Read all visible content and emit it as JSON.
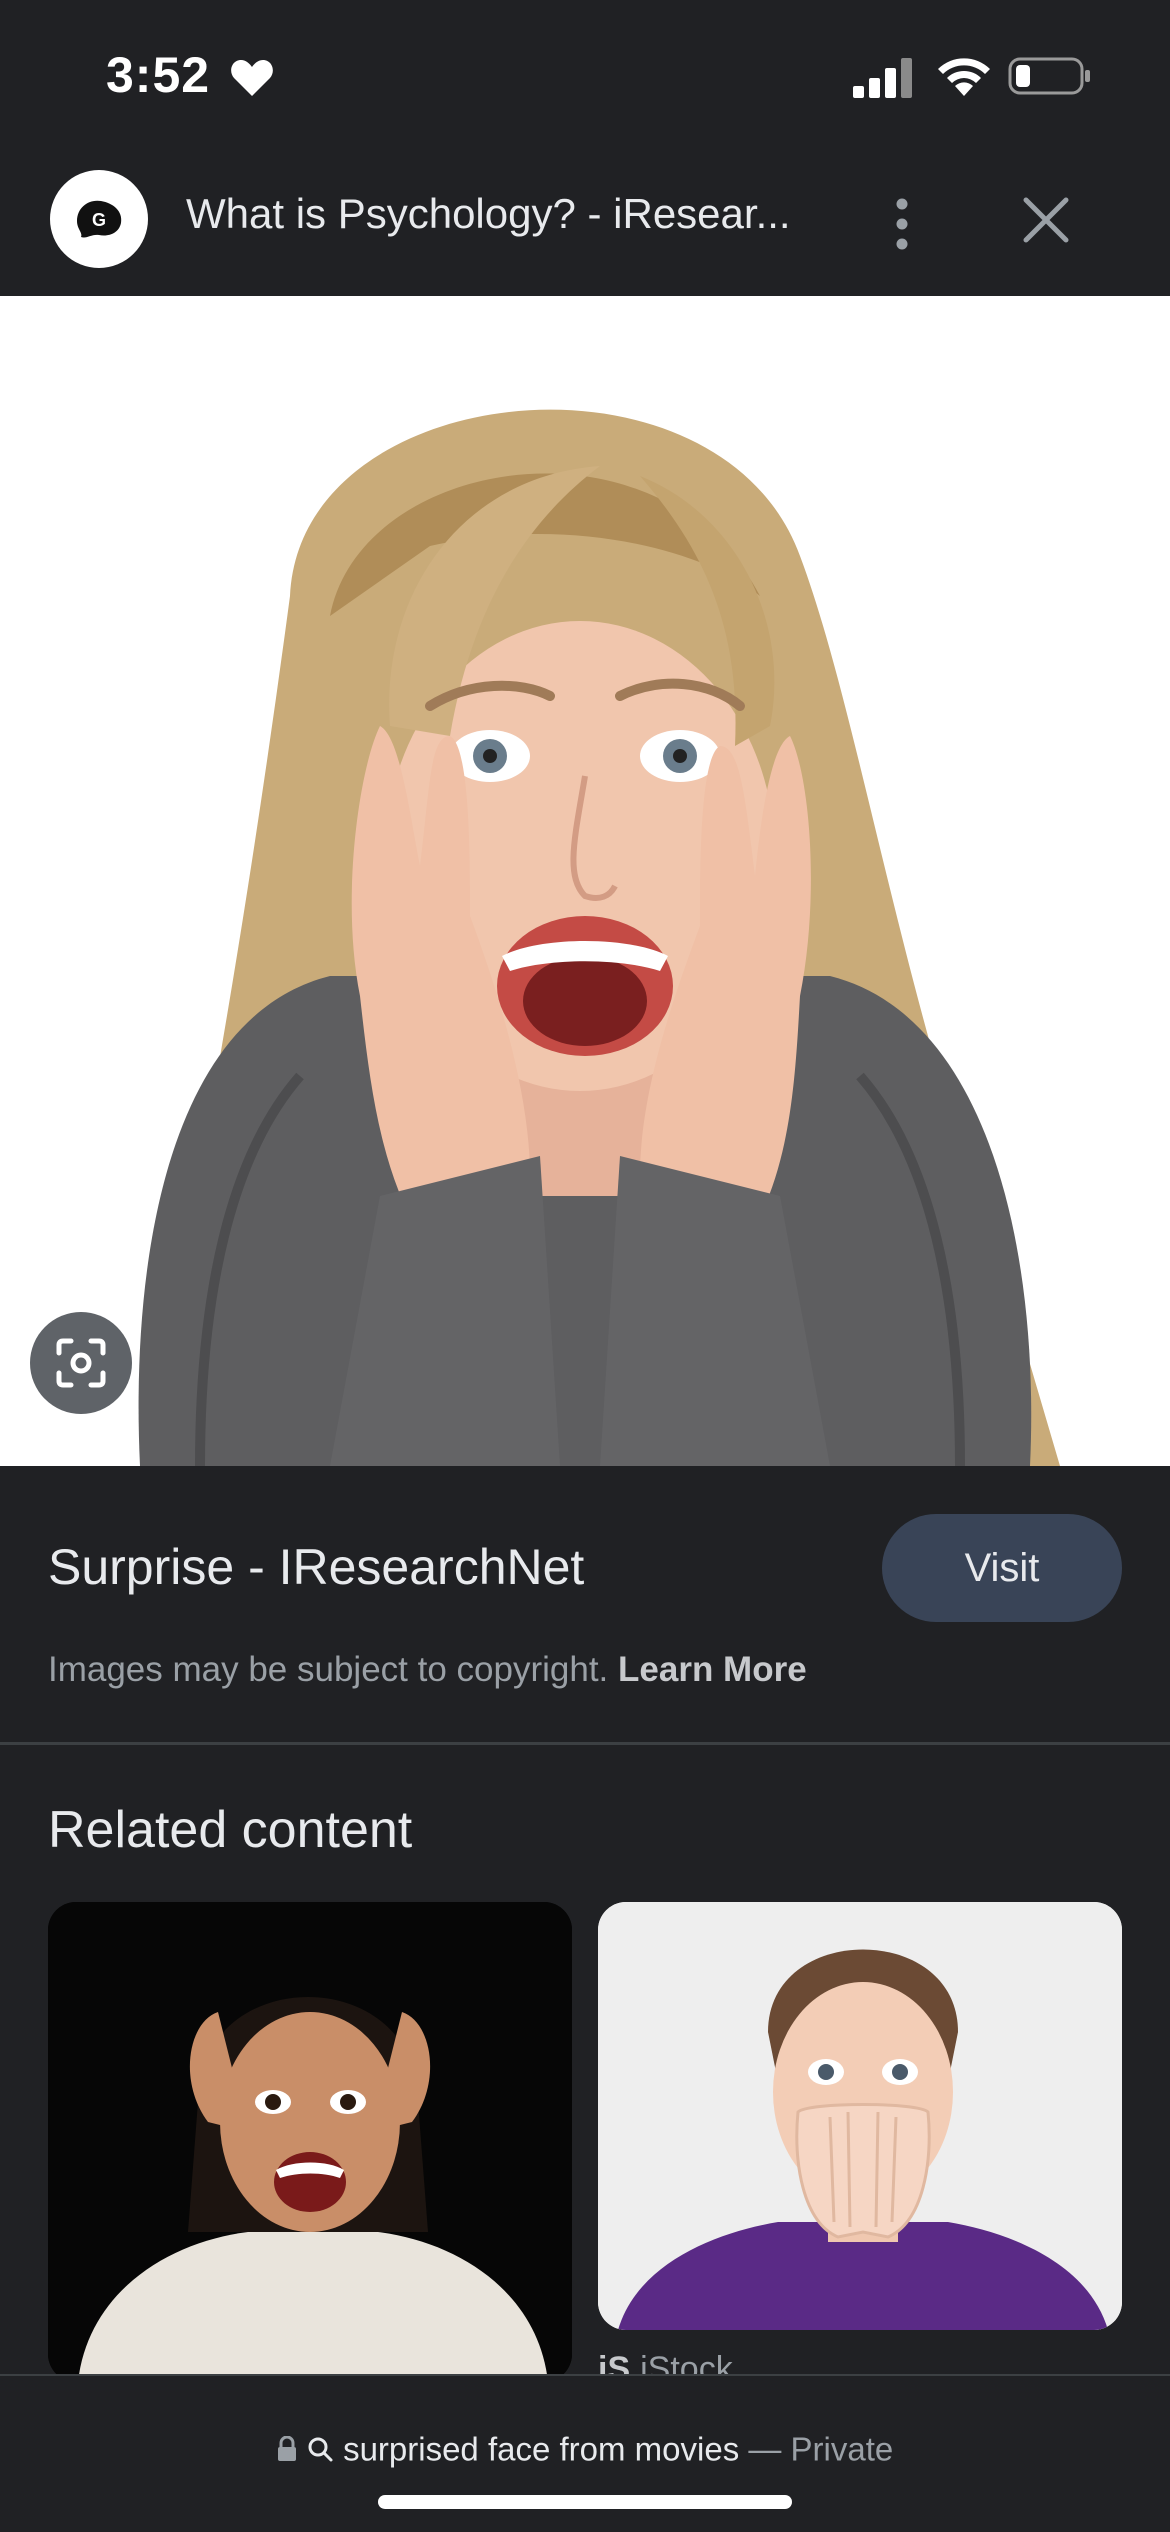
{
  "status_bar": {
    "time": "3:52",
    "icons": [
      "heart-icon",
      "cellular-signal-icon",
      "wifi-icon",
      "battery-icon"
    ]
  },
  "header": {
    "title": "What is Psychology? - iResear...",
    "icons": [
      "site-logo-icon",
      "more-vertical-icon",
      "close-icon"
    ]
  },
  "image_viewer": {
    "lens_icon": "google-lens-icon"
  },
  "result": {
    "title": "Surprise - IResearchNet",
    "visit_label": "Visit",
    "copyright_text": "Images may be subject to copyright.",
    "learn_more_label": "Learn More"
  },
  "related": {
    "heading": "Related content",
    "items": [
      {
        "source": ""
      },
      {
        "source_logo": "iS",
        "source": "iStock"
      }
    ]
  },
  "bottom_bar": {
    "query": "surprised face from movies",
    "separator": "—",
    "mode": "Private"
  },
  "colors": {
    "background": "#202124",
    "visit_button": "#394457",
    "text_primary": "#e8eaed",
    "text_secondary": "#9aa0a6"
  }
}
